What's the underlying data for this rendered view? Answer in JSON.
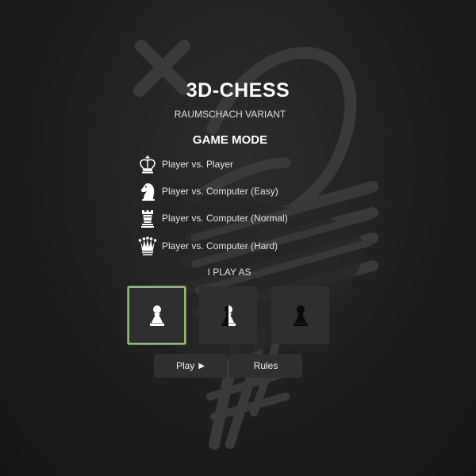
{
  "app": {
    "title": "3D-CHESS",
    "subtitle": "RAUMSCHACH VARIANT"
  },
  "game_mode": {
    "heading": "GAME MODE",
    "options": [
      {
        "label": "Player vs. Player",
        "icon": "king-icon"
      },
      {
        "label": "Player vs. Computer (Easy)",
        "icon": "knight-icon"
      },
      {
        "label": "Player vs. Computer (Normal)",
        "icon": "rook-icon"
      },
      {
        "label": "Player vs. Computer (Hard)",
        "icon": "queen-icon"
      }
    ]
  },
  "play_as": {
    "label": "I PLAY AS",
    "options": [
      {
        "name": "white",
        "icon": "white-pawn-icon",
        "selected": true
      },
      {
        "name": "random",
        "icon": "half-pawn-icon",
        "selected": false
      },
      {
        "name": "black",
        "icon": "black-pawn-icon",
        "selected": false
      }
    ]
  },
  "buttons": {
    "play_label": "Play",
    "play_icon": "▶",
    "rules_label": "Rules"
  },
  "colors": {
    "background": "#1b1b1b",
    "tile": "#2f2f2f",
    "selected_border": "#93b97a",
    "logo_stroke": "#3a3a3a"
  }
}
